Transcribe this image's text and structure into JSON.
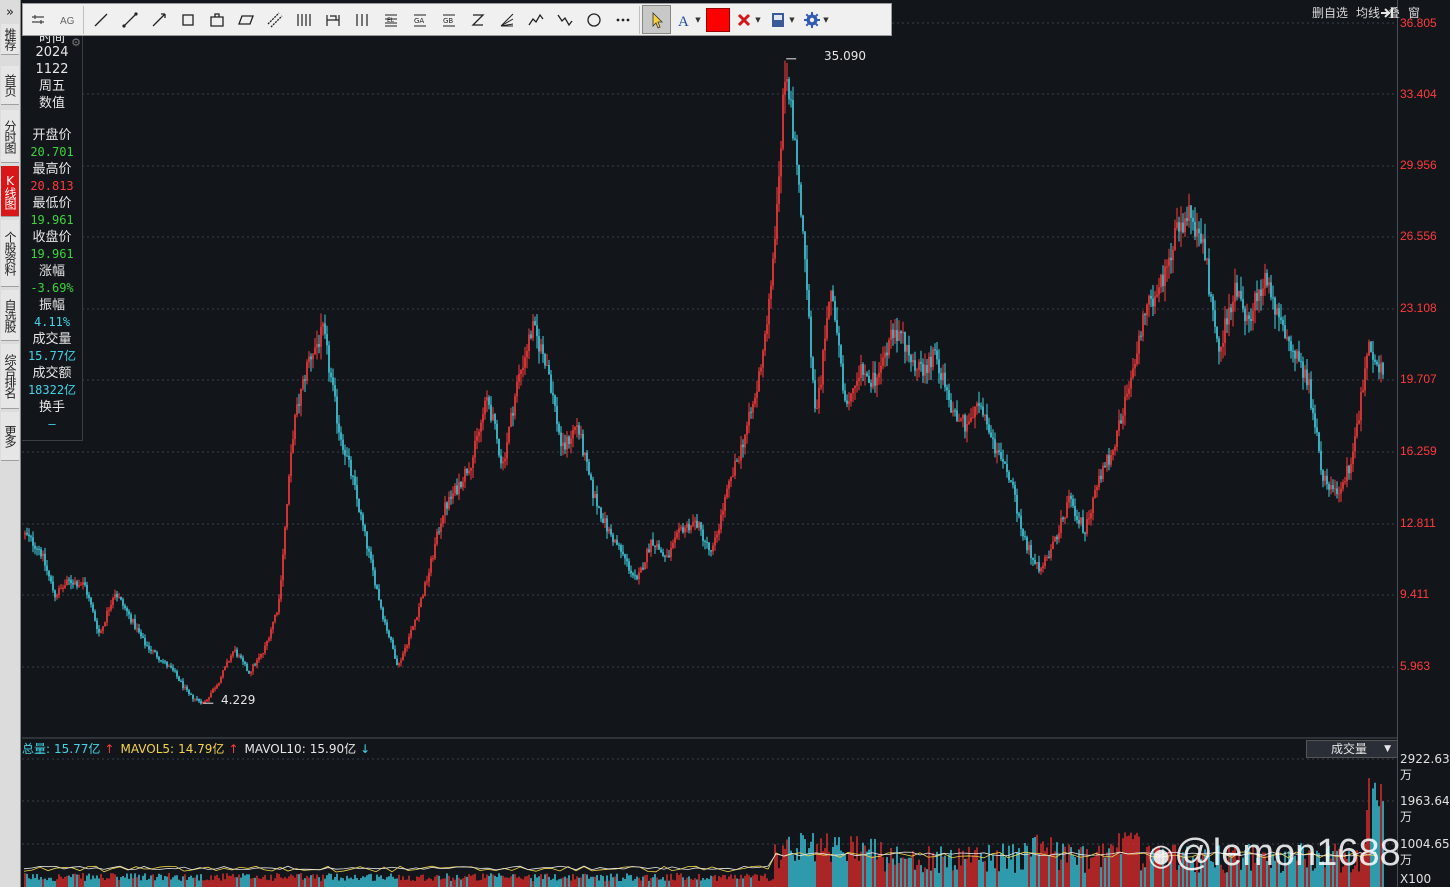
{
  "nav": {
    "expand": "»",
    "items": [
      {
        "label": "推荐",
        "active": false
      },
      {
        "label": "首页",
        "active": false
      },
      {
        "label": "分时图",
        "active": false
      },
      {
        "label": "K线图",
        "active": true
      },
      {
        "label": "个股资料",
        "active": false
      },
      {
        "label": "自选股",
        "active": false
      },
      {
        "label": "综合排名",
        "active": false
      },
      {
        "label": "更多",
        "active": false
      }
    ]
  },
  "info": {
    "partial": "时间",
    "year": "2024",
    "date": "1122",
    "weekday": "周五",
    "value_title": "数值",
    "open_label": "开盘价",
    "open": "20.701",
    "high_label": "最高价",
    "high": "20.813",
    "low_label": "最低价",
    "low": "19.961",
    "close_label": "收盘价",
    "close": "19.961",
    "change_label": "涨幅",
    "change": "-3.69%",
    "amplitude_label": "振幅",
    "amplitude": "4.11%",
    "volume_label": "成交量",
    "volume": "15.77亿",
    "turnover_label": "成交额",
    "turnover": "18322亿",
    "handover_label": "换手",
    "handover": "—"
  },
  "toolbar": {
    "tools": [
      "adjust-icon",
      "text-style-icon",
      "line-icon",
      "segment-icon",
      "ray-icon",
      "rect-icon",
      "box-icon",
      "parallelogram-icon",
      "parallel-lines-icon",
      "vertical-lines-icon",
      "period-icon",
      "grid-lines-icon",
      "fib-icon",
      "gann-icon",
      "gb-icon",
      "zigzag-icon",
      "fan-icon",
      "wave-icon",
      "wave2-icon",
      "circle-icon",
      "more-icon"
    ],
    "color": "#ff0000"
  },
  "topright": {
    "delete_watch": "删自选",
    "ma_lines": "均线",
    "overlay": "叠",
    "window": "窗"
  },
  "price_axis": {
    "labels": [
      "36.805",
      "33.404",
      "29.956",
      "26.556",
      "23.108",
      "19.707",
      "16.259",
      "12.811",
      "9.411",
      "5.963"
    ]
  },
  "annotations": {
    "high": "35.090",
    "low": "4.229"
  },
  "volume": {
    "total_label": "总量:",
    "total": "15.77亿",
    "total_arrow": "↑",
    "mavol5_label": "MAVOL5:",
    "mavol5": "14.79亿",
    "mavol5_arrow": "↑",
    "mavol10_label": "MAVOL10:",
    "mavol10": "15.90亿",
    "mavol10_arrow": "↓",
    "selector": "成交量",
    "axis": [
      "2922.63万",
      "1963.64万",
      "1004.65万",
      "X100"
    ]
  },
  "watermark": "@lemon1688",
  "colors": {
    "up": "#ff3b3b",
    "down": "#43d3e6",
    "grid": "#3a3f47",
    "bg": "#12161b"
  },
  "chart_data": {
    "type": "line",
    "title": "",
    "ylim": [
      4.229,
      36.805
    ],
    "series": [
      {
        "values": [
          12.3,
          11.6,
          9.4,
          10.1,
          9.9,
          7.5,
          9.6,
          8.4,
          7.1,
          6.4,
          5.7,
          4.6,
          4.229,
          5.3,
          6.8,
          5.7,
          6.7,
          9.0,
          17.5,
          20.7,
          22.0,
          17.5,
          14.8,
          11.5,
          8.4,
          6.0,
          7.9,
          10.3,
          13.4,
          14.6,
          16.0,
          18.9,
          15.6,
          19.6,
          22.2,
          20.5,
          16.3,
          17.6,
          14.4,
          12.6,
          11.4,
          10.0,
          12.1,
          11.1,
          12.6,
          12.9,
          11.3,
          14.2,
          16.5,
          19.0,
          24.0,
          35.09,
          28.0,
          17.5,
          24.5,
          18.0,
          20.5,
          19.5,
          21.8,
          21.5,
          20.0,
          21.0,
          18.5,
          17.6,
          18.5,
          16.5,
          15.0,
          12.0,
          10.5,
          12.0,
          14.0,
          12.5,
          15.0,
          16.5,
          19.5,
          23.0,
          24.0,
          26.5,
          27.5,
          26.0,
          21.0,
          24.0,
          22.5,
          24.5,
          23.0,
          21.0,
          19.5,
          15.0,
          14.3,
          16.0,
          21.5,
          19.961
        ]
      }
    ]
  }
}
